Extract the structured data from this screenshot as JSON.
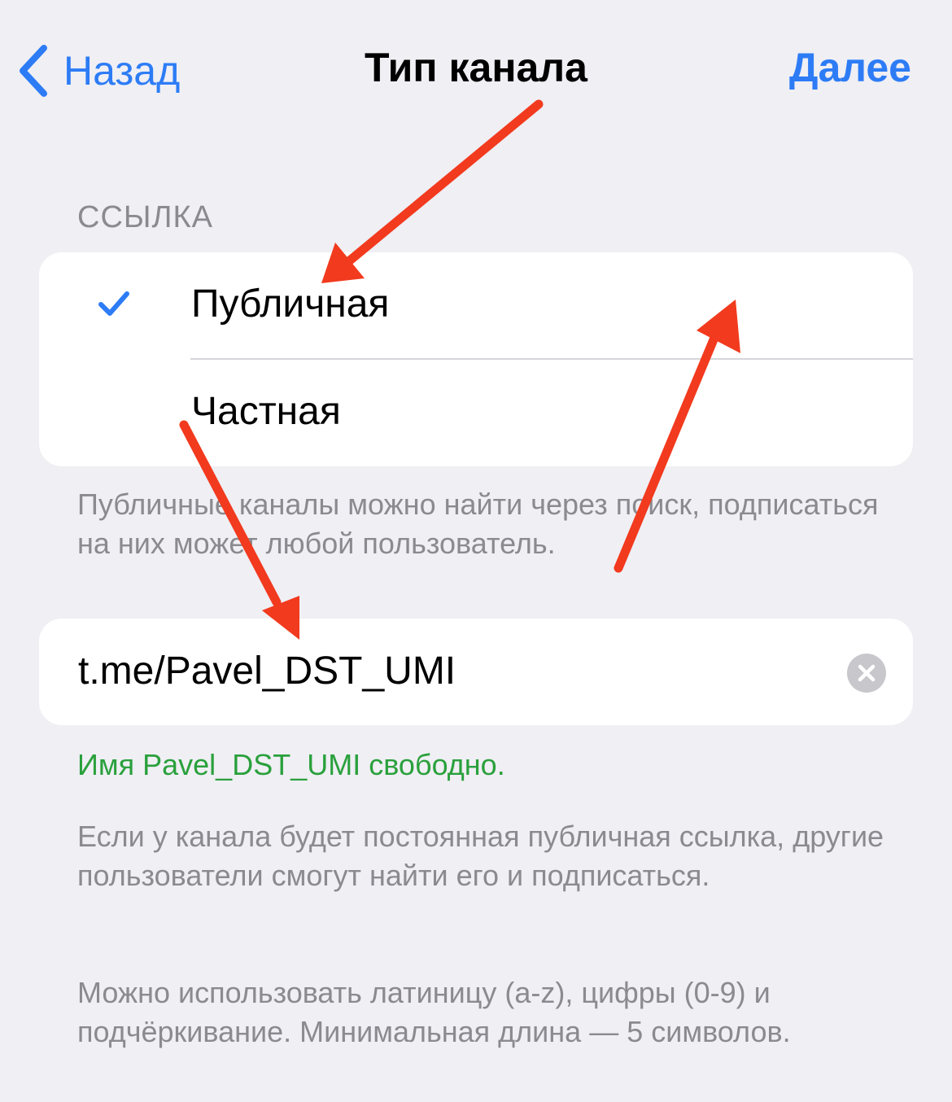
{
  "nav": {
    "back_label": "Назад",
    "title": "Тип канала",
    "next_label": "Далее"
  },
  "link_type": {
    "header": "ССЫЛКА",
    "options": [
      {
        "label": "Публичная",
        "selected": true
      },
      {
        "label": "Частная",
        "selected": false
      }
    ],
    "footer": "Публичные каналы можно найти через поиск, подписаться на них может любой пользователь."
  },
  "link_field": {
    "value": "t.me/Pavel_DST_UMI",
    "status": "Имя Pavel_DST_UMI свободно.",
    "footer_1": "Если у канала будет постоянная публичная ссылка, другие пользователи смогут найти его и подписаться.",
    "footer_2": "Можно использовать латиницу (a-z), цифры (0-9) и подчёркивание. Минимальная длина — 5 символов."
  },
  "colors": {
    "accent": "#2d7cf6",
    "success": "#2aa03c",
    "secondary_text": "#8a8a8f",
    "background": "#efeff4",
    "annotation_arrow": "#f23a1e"
  },
  "icons": {
    "back": "chevron-left-icon",
    "check": "checkmark-icon",
    "clear": "clear-circle-icon"
  }
}
